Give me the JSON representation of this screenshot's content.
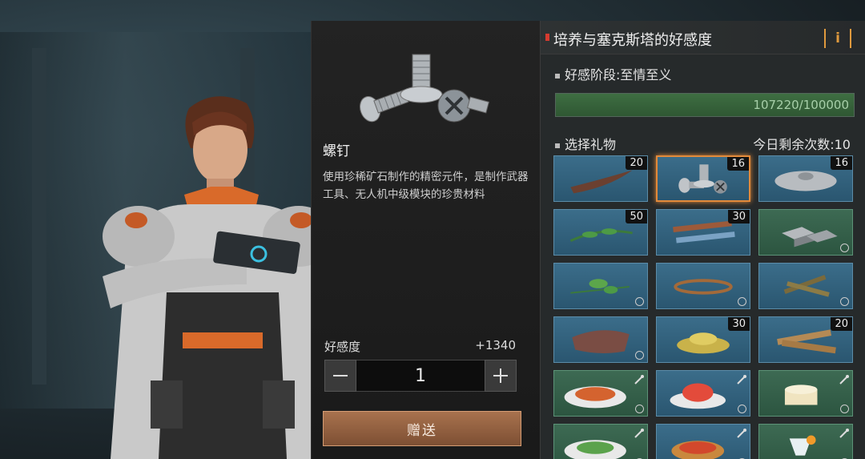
{
  "item": {
    "name": "螺钉",
    "description": "使用珍稀矿石制作的精密元件，是制作武器工具、无人机中级模块的珍贵材料",
    "affinity_label": "好感度",
    "affinity_gain": "+1340",
    "quantity": "1",
    "gift_button": "赠送",
    "icon": "screws-icon"
  },
  "panel": {
    "title": "培养与塞克斯塔的好感度",
    "info_label": "i",
    "stage_label": "好感阶段:至情至义",
    "progress_text": "107220/100000",
    "progress_fraction": 1.0,
    "gift_section_label": "选择礼物",
    "remaining_label": "今日剩余次数:10"
  },
  "gifts": [
    {
      "name": "horn-item",
      "count": "20",
      "color": "blue",
      "selected": false
    },
    {
      "name": "screws-item",
      "count": "16",
      "color": "blue",
      "selected": true
    },
    {
      "name": "saw-blade-item",
      "count": "16",
      "color": "blue",
      "selected": false
    },
    {
      "name": "herb-item",
      "count": "50",
      "color": "blue",
      "selected": false
    },
    {
      "name": "pipes-item",
      "count": "30",
      "color": "blue",
      "selected": false
    },
    {
      "name": "metal-ingots-item",
      "count": "",
      "color": "green",
      "selected": false
    },
    {
      "name": "leaf-herb-item",
      "count": "",
      "color": "blue",
      "selected": false
    },
    {
      "name": "rubber-bands-item",
      "count": "",
      "color": "blue",
      "selected": false
    },
    {
      "name": "sticks-item",
      "count": "",
      "color": "blue",
      "selected": false
    },
    {
      "name": "meat-item",
      "count": "",
      "color": "blue",
      "selected": false
    },
    {
      "name": "gold-pile-item",
      "count": "30",
      "color": "blue",
      "selected": false
    },
    {
      "name": "planks-item",
      "count": "20",
      "color": "blue",
      "selected": false
    },
    {
      "name": "spaghetti-dish",
      "count": "",
      "color": "green",
      "selected": false
    },
    {
      "name": "jelly-dessert-dish",
      "count": "",
      "color": "blue",
      "selected": false
    },
    {
      "name": "cake-dish",
      "count": "",
      "color": "green",
      "selected": false
    },
    {
      "name": "salad-dish",
      "count": "",
      "color": "green",
      "selected": false
    },
    {
      "name": "tart-dish",
      "count": "",
      "color": "blue",
      "selected": false
    },
    {
      "name": "drink-dish",
      "count": "",
      "color": "green",
      "selected": false
    }
  ],
  "colors": {
    "accent": "#e38a3a",
    "gift_button": "#8f5e40",
    "progress": "#3e6e42",
    "title_marker": "#d63a2f"
  }
}
